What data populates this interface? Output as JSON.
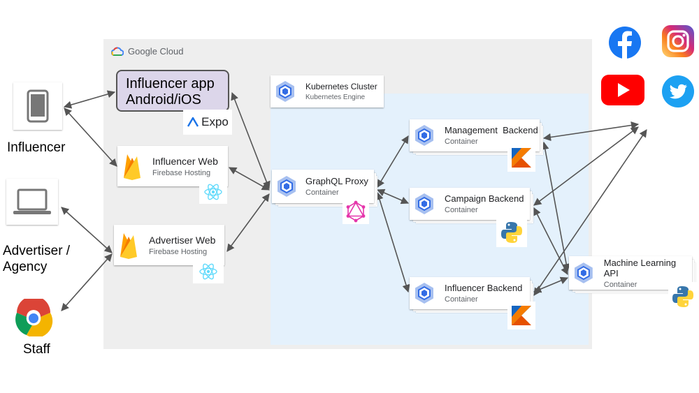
{
  "google_cloud": {
    "label": "Google Cloud"
  },
  "kubernetes": {
    "title": "Kubernetes Cluster",
    "subtitle": "Kubernetes Engine"
  },
  "influencer_app": {
    "line1": "Influencer app",
    "line2": "Android/iOS",
    "expo_label": "Expo"
  },
  "nodes": {
    "influencer_web": {
      "title": "Influencer Web",
      "subtitle": "Firebase Hosting"
    },
    "advertiser_web": {
      "title": "Advertiser Web",
      "subtitle": "Firebase Hosting"
    },
    "graphql_proxy": {
      "title": "GraphQL Proxy",
      "subtitle": "Container"
    },
    "management_backend": {
      "title": "Management  Backend",
      "subtitle": "Container"
    },
    "campaign_backend": {
      "title": "Campaign Backend",
      "subtitle": "Container"
    },
    "influencer_backend": {
      "title": "Influencer Backend",
      "subtitle": "Container"
    },
    "ml_api": {
      "title": "Machine Learning API",
      "subtitle": "Container"
    }
  },
  "actors": {
    "influencer": "Influencer",
    "advertiser_line1": "Advertiser /",
    "advertiser_line2": "Agency",
    "staff": "Staff"
  },
  "social": [
    "facebook-icon",
    "instagram-icon",
    "youtube-icon",
    "twitter-icon"
  ],
  "colors": {
    "gcp_area": "#eeeeee",
    "k8s_area": "#e4f1fc",
    "app_box": "#dcd6ea",
    "facebook": "#1877f2",
    "youtube": "#ff0000",
    "twitter": "#1da1f2",
    "react": "#61dafb",
    "graphql": "#e535ab",
    "k8s_blue": "#326ce5"
  }
}
